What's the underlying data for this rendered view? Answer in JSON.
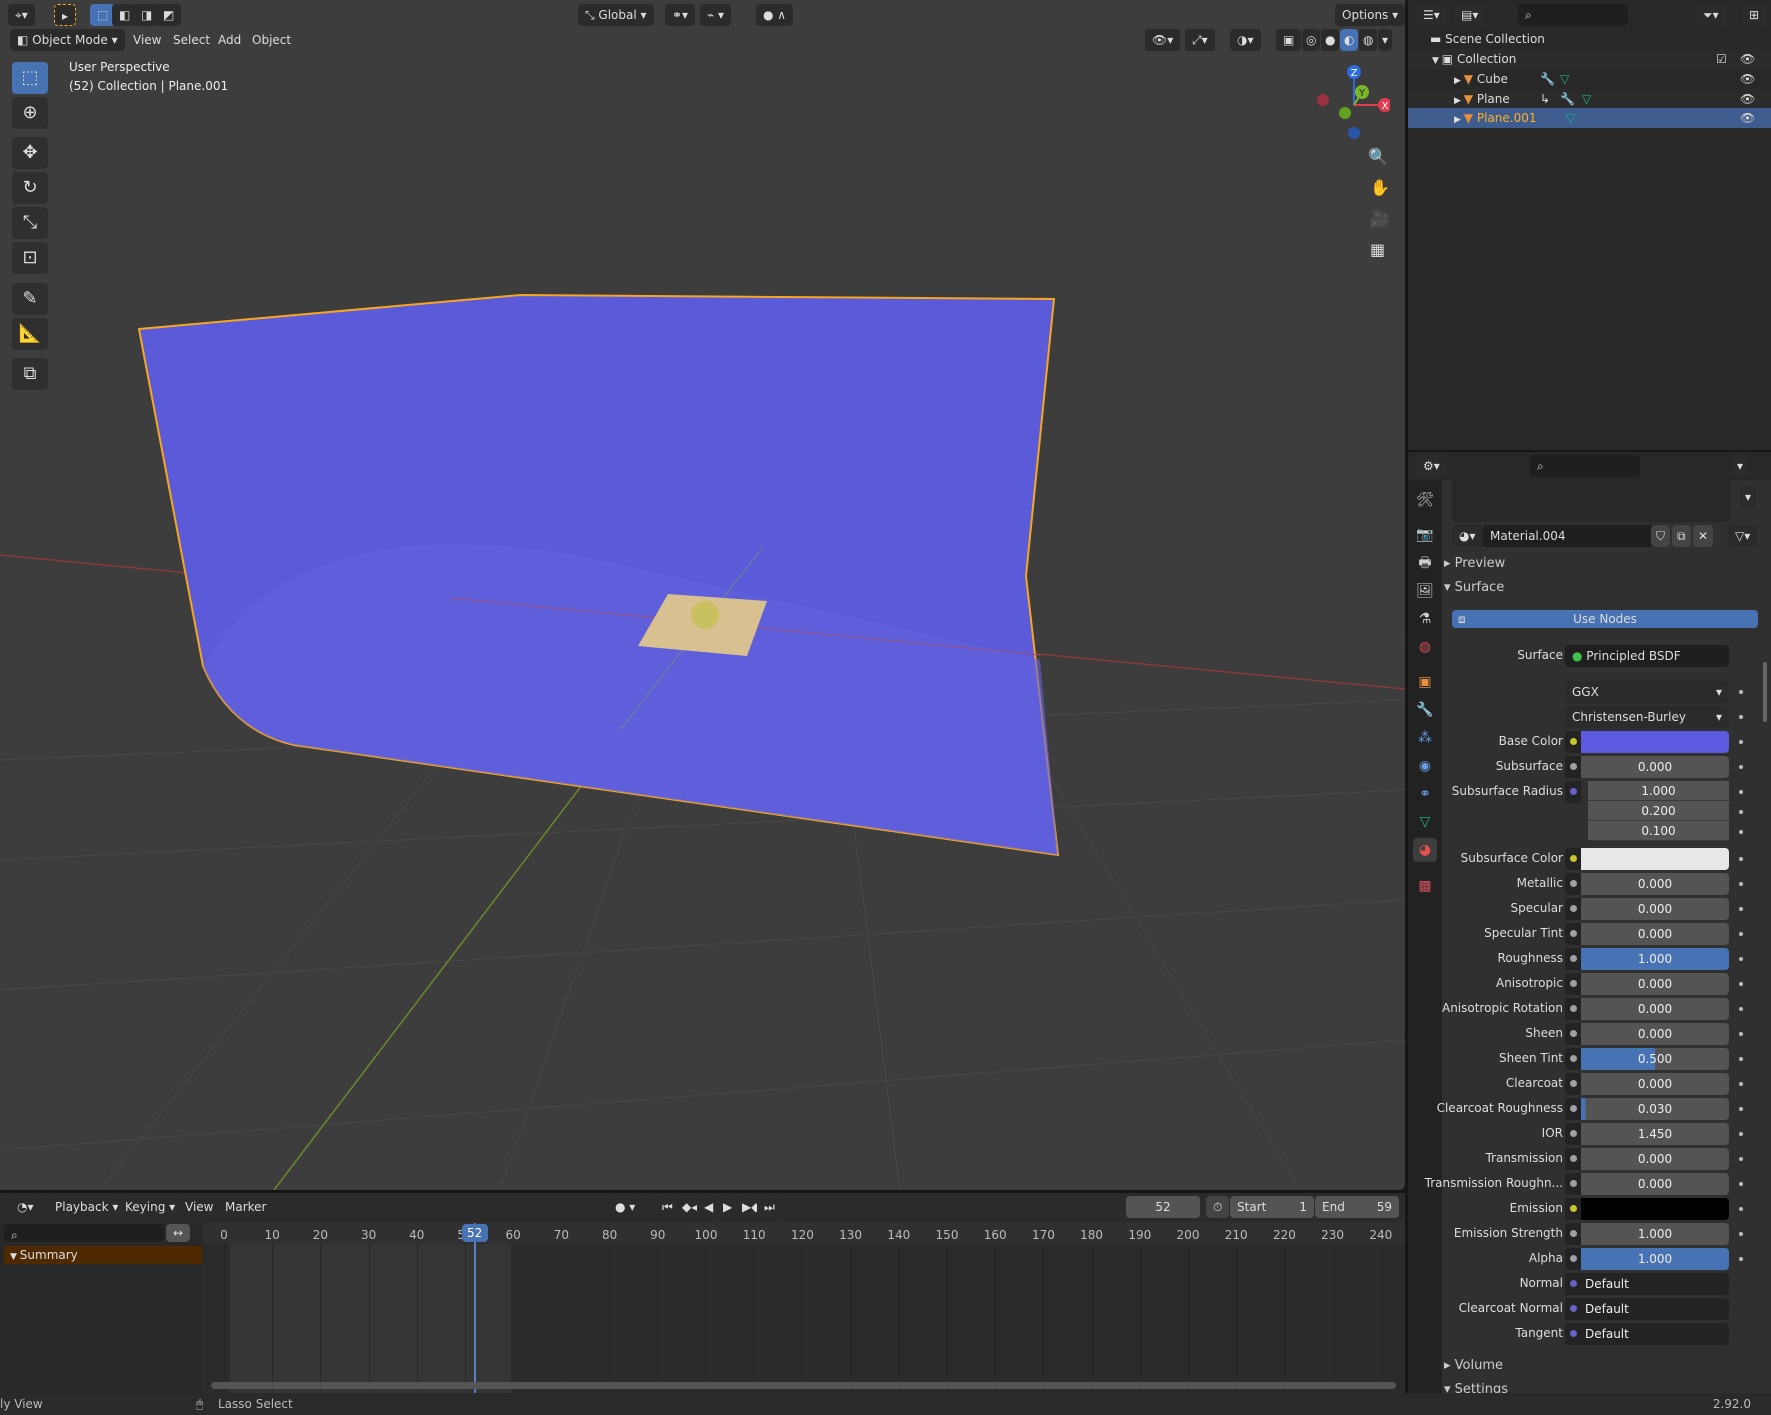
{
  "viewport": {
    "header": {
      "transform_orientation": "Global",
      "options": "Options",
      "mode": "Object Mode",
      "menus": [
        "View",
        "Select",
        "Add",
        "Object"
      ]
    },
    "overlay": {
      "line1": "User Perspective",
      "line2": "(52) Collection | Plane.001"
    },
    "gizmo": {
      "x": "X",
      "y": "Y",
      "z": "Z"
    },
    "plane_color": "#5b5ad8",
    "selection_color": "#f5a623"
  },
  "outliner": {
    "scene": "Scene Collection",
    "collection": "Collection",
    "items": [
      {
        "name": "Cube"
      },
      {
        "name": "Plane"
      },
      {
        "name": "Plane.001",
        "selected": true
      }
    ]
  },
  "properties": {
    "material": "Material.004",
    "panels": {
      "preview": "Preview",
      "surface": "Surface",
      "volume": "Volume",
      "settings": "Settings"
    },
    "use_nodes": "Use Nodes",
    "surface_label": "Surface",
    "surface_value": "Principled BSDF",
    "distribution": "GGX",
    "subsurface_method": "Christensen-Burley",
    "rows": [
      {
        "label": "Base Color",
        "type": "color",
        "color": "#5b5ae0",
        "socket": "#c7c729"
      },
      {
        "label": "Subsurface",
        "value": "0.000",
        "socket": "#a1a1a1"
      },
      {
        "label": "Subsurface Radius",
        "values": [
          "1.000",
          "0.200",
          "0.100"
        ],
        "socket": "#6363c7"
      },
      {
        "label": "Subsurface Color",
        "type": "color",
        "color": "#e8e8e8",
        "socket": "#c7c729"
      },
      {
        "label": "Metallic",
        "value": "0.000",
        "socket": "#a1a1a1"
      },
      {
        "label": "Specular",
        "value": "0.000",
        "socket": "#a1a1a1"
      },
      {
        "label": "Specular Tint",
        "value": "0.000",
        "socket": "#a1a1a1"
      },
      {
        "label": "Roughness",
        "value": "1.000",
        "fill": 1.0,
        "socket": "#a1a1a1"
      },
      {
        "label": "Anisotropic",
        "value": "0.000",
        "socket": "#a1a1a1"
      },
      {
        "label": "Anisotropic Rotation",
        "value": "0.000",
        "socket": "#a1a1a1"
      },
      {
        "label": "Sheen",
        "value": "0.000",
        "socket": "#a1a1a1"
      },
      {
        "label": "Sheen Tint",
        "value": "0.500",
        "fill": 0.5,
        "socket": "#a1a1a1"
      },
      {
        "label": "Clearcoat",
        "value": "0.000",
        "socket": "#a1a1a1"
      },
      {
        "label": "Clearcoat Roughness",
        "value": "0.030",
        "fill": 0.03,
        "socket": "#a1a1a1"
      },
      {
        "label": "IOR",
        "value": "1.450",
        "socket": "#a1a1a1"
      },
      {
        "label": "Transmission",
        "value": "0.000",
        "socket": "#a1a1a1"
      },
      {
        "label": "Transmission Roughn...",
        "value": "0.000",
        "socket": "#a1a1a1"
      },
      {
        "label": "Emission",
        "type": "color",
        "color": "#000000",
        "socket": "#c7c729"
      },
      {
        "label": "Emission Strength",
        "value": "1.000",
        "socket": "#a1a1a1"
      },
      {
        "label": "Alpha",
        "value": "1.000",
        "fill": 1.0,
        "socket": "#a1a1a1"
      },
      {
        "label": "Normal",
        "type": "link",
        "value": "Default",
        "socket": "#6363c7"
      },
      {
        "label": "Clearcoat Normal",
        "type": "link",
        "value": "Default",
        "socket": "#6363c7"
      },
      {
        "label": "Tangent",
        "type": "link",
        "value": "Default",
        "socket": "#6363c7"
      }
    ]
  },
  "timeline": {
    "menus": [
      "Playback",
      "Keying",
      "View",
      "Marker"
    ],
    "current_frame": 52,
    "start_label": "Start",
    "start": 1,
    "end_label": "End",
    "end": 59,
    "ticks": [
      0,
      10,
      20,
      30,
      40,
      50,
      60,
      70,
      80,
      90,
      100,
      110,
      120,
      130,
      140,
      150,
      160,
      170,
      180,
      190,
      200,
      210,
      220,
      230,
      240
    ],
    "summary": "Summary"
  },
  "status": {
    "left": "ly View",
    "middle": "Lasso Select",
    "version": "2.92.0"
  }
}
